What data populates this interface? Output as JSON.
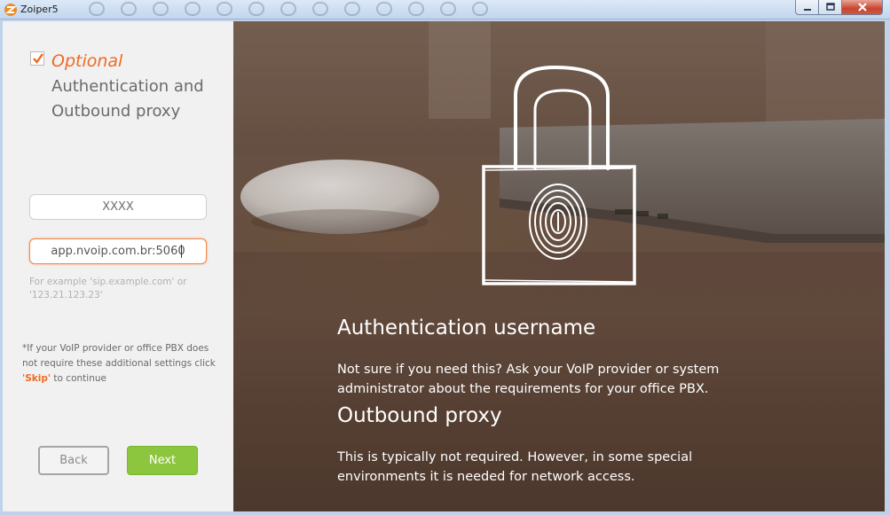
{
  "window": {
    "title": "Zoiper5"
  },
  "left_panel": {
    "optional_label": "Optional",
    "optional_checked": true,
    "heading": "Authentication and Outbound proxy",
    "username_field": {
      "value": "XXXX"
    },
    "proxy_field": {
      "value": "app.nvoip.com.br:5060"
    },
    "example_hint": "For example 'sip.example.com' or '123.21.123.23'",
    "note_before": "*If your VoIP provider or office PBX does not require these additional settings click ",
    "note_skip": "'Skip'",
    "note_after": " to continue",
    "back_label": "Back",
    "next_label": "Next"
  },
  "right_panel": {
    "auth_heading": "Authentication username",
    "auth_text": "Not sure if you need this? Ask your VoIP provider or system administrator about the requirements for your office PBX.",
    "proxy_heading": "Outbound proxy",
    "proxy_text": "This is typically not required. However, in some special environments it is needed for network access."
  },
  "colors": {
    "accent": "#f06a24",
    "next_button": "#8cc63e"
  },
  "icons": [
    "app-logo-icon",
    "minimize-icon",
    "maximize-icon",
    "close-icon",
    "checkmark-icon",
    "padlock-fingerprint-icon"
  ]
}
